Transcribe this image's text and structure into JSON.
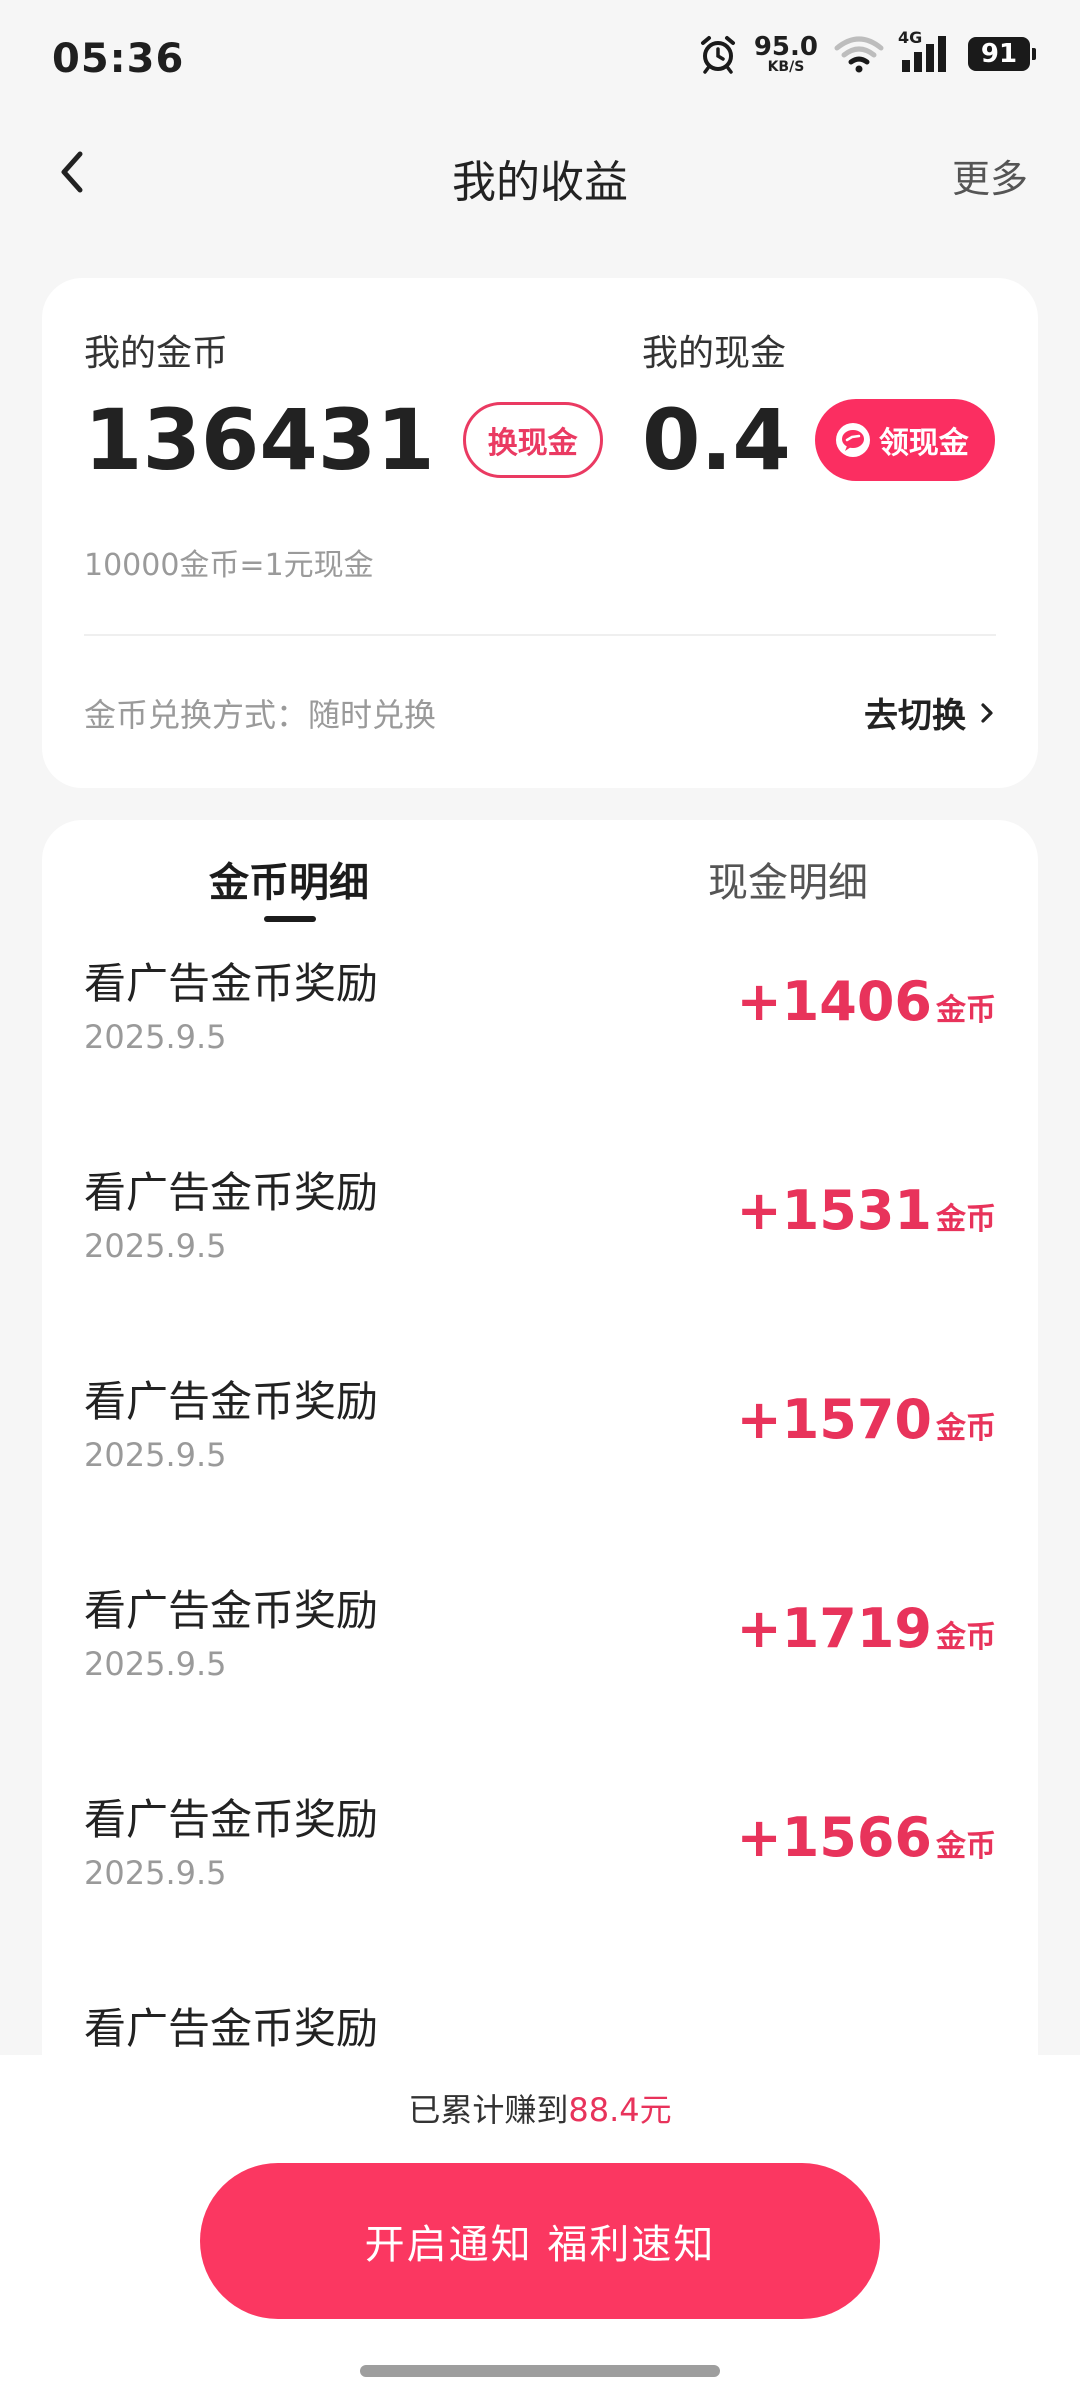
{
  "status_bar": {
    "time": "05:36",
    "net_speed": "95.0",
    "net_unit": "KB/S",
    "network_type": "4G",
    "battery": "91"
  },
  "header": {
    "title": "我的收益",
    "more": "更多"
  },
  "balance": {
    "coin_label": "我的金币",
    "coin_value": "136431",
    "exchange_button": "换现金",
    "cash_label": "我的现金",
    "cash_value": "0.4",
    "claim_button": "领现金",
    "rate_note": "10000金币=1元现金",
    "method_text": "金币兑换方式：随时兑换",
    "switch_link": "去切换"
  },
  "tabs": [
    {
      "label": "金币明细",
      "active": true
    },
    {
      "label": "现金明细",
      "active": false
    }
  ],
  "records": [
    {
      "title": "看广告金币奖励",
      "date": "2025.9.5",
      "amount": "+1406",
      "unit": "金币"
    },
    {
      "title": "看广告金币奖励",
      "date": "2025.9.5",
      "amount": "+1531",
      "unit": "金币"
    },
    {
      "title": "看广告金币奖励",
      "date": "2025.9.5",
      "amount": "+1570",
      "unit": "金币"
    },
    {
      "title": "看广告金币奖励",
      "date": "2025.9.5",
      "amount": "+1719",
      "unit": "金币"
    },
    {
      "title": "看广告金币奖励",
      "date": "2025.9.5",
      "amount": "+1566",
      "unit": "金币"
    },
    {
      "title": "看广告金币奖励",
      "date": "",
      "amount": "",
      "unit": ""
    }
  ],
  "footer": {
    "earned_prefix": "已累计赚到",
    "earned_amount": "88.4元",
    "notify_button": "开启通知 福利速知"
  },
  "colors": {
    "accent": "#fb2e61",
    "amount_text": "#e8335b"
  }
}
